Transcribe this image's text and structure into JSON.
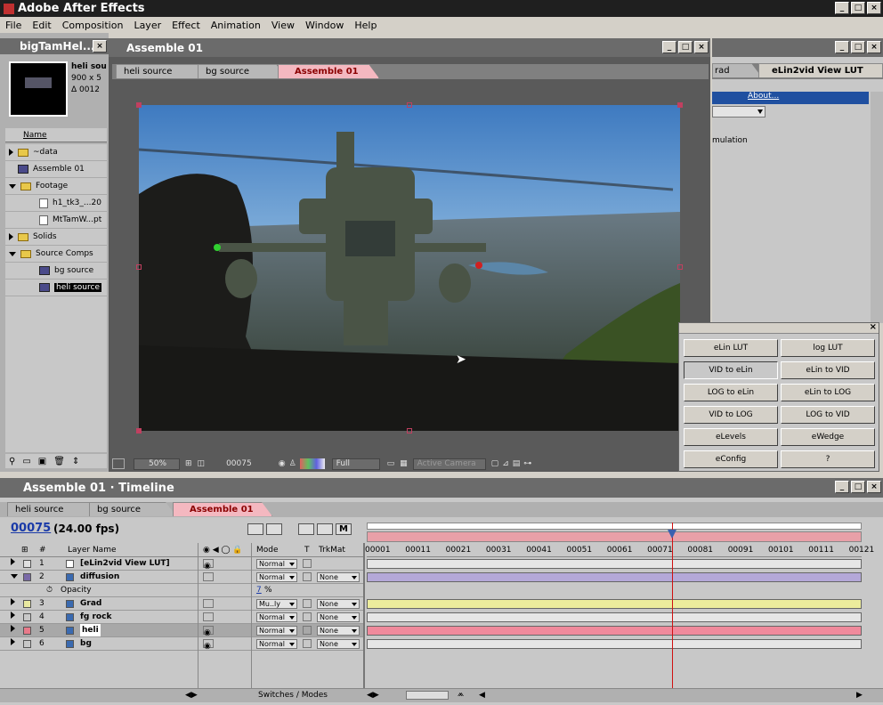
{
  "app": {
    "title": "Adobe After Effects"
  },
  "menu": [
    "File",
    "Edit",
    "Composition",
    "Layer",
    "Effect",
    "Animation",
    "View",
    "Window",
    "Help"
  ],
  "project": {
    "title": "bigTamHel...",
    "selected_name": "heli sou",
    "selected_dims": "900 x 5",
    "selected_dur": "Δ 0012",
    "column_name": "Name",
    "items": [
      {
        "label": "~data",
        "type": "folder",
        "open": false,
        "indent": 0
      },
      {
        "label": "Assemble 01",
        "type": "comp",
        "indent": 0
      },
      {
        "label": "Footage",
        "type": "folder",
        "open": true,
        "indent": 0
      },
      {
        "label": "h1_tk3_...20",
        "type": "seq",
        "indent": 1
      },
      {
        "label": "MtTamW...pt",
        "type": "file",
        "indent": 1
      },
      {
        "label": "Solids",
        "type": "folder",
        "open": false,
        "indent": 0
      },
      {
        "label": "Source Comps",
        "type": "folder",
        "open": true,
        "indent": 0
      },
      {
        "label": "bg source",
        "type": "comp",
        "indent": 1
      },
      {
        "label": "heli source",
        "type": "comp",
        "indent": 1,
        "selected": true
      }
    ]
  },
  "comp": {
    "title": "Assemble 01",
    "tabs": [
      "heli source",
      "bg source",
      "Assemble 01"
    ],
    "zoom": "50%",
    "frame": "00075",
    "resolution": "Full",
    "camera": "Active Camera"
  },
  "effect_panel": {
    "tabs": [
      "rad",
      "eLin2vid View LUT"
    ],
    "about": "About...",
    "text": "mulation"
  },
  "lut_panel": {
    "buttons": [
      "eLin LUT",
      "log LUT",
      "VID to eLin",
      "eLin to VID",
      "LOG to eLin",
      "eLin to LOG",
      "VID to LOG",
      "LOG to VID",
      "eLevels",
      "eWedge",
      "eConfig",
      "?"
    ]
  },
  "timeline": {
    "title": "Assemble 01 · Timeline",
    "tabs": [
      "heli source",
      "bg source",
      "Assemble 01"
    ],
    "timecode": "00075",
    "fps": "(24.00 fps)",
    "headers": {
      "num": "#",
      "layer": "Layer Name",
      "mode": "Mode",
      "t": "T",
      "trkmat": "TrkMat"
    },
    "layers": [
      {
        "num": "1",
        "name": "[eLin2vid View LUT]",
        "mode": "Normal",
        "trkmat": "",
        "color": "#e0e0e0",
        "bar": "#e6e6e6"
      },
      {
        "num": "2",
        "name": "diffusion",
        "mode": "Normal",
        "trkmat": "None",
        "color": "#7a6aa8",
        "bar": "#b4a8d8",
        "open": true
      },
      {
        "num": "3",
        "name": "Grad",
        "mode": "Mu..ly",
        "trkmat": "None",
        "color": "#e8e8a0",
        "bar": "#ecec9c"
      },
      {
        "num": "4",
        "name": "fg rock",
        "mode": "Normal",
        "trkmat": "None",
        "color": "#c8c8c8",
        "bar": "#e6e6e6"
      },
      {
        "num": "5",
        "name": "heli",
        "mode": "Normal",
        "trkmat": "None",
        "color": "#e87a8a",
        "bar": "#f08a9c",
        "selected": true
      },
      {
        "num": "6",
        "name": "bg",
        "mode": "Normal",
        "trkmat": "None",
        "color": "#c8c8c8",
        "bar": "#e6e6e6"
      }
    ],
    "opacity_label": "Opacity",
    "opacity_value": "7",
    "opacity_unit": "%",
    "ruler": [
      "00001",
      "00011",
      "00021",
      "00031",
      "00041",
      "00051",
      "00061",
      "00071",
      "00081",
      "00091",
      "00101",
      "00111",
      "00121"
    ],
    "switches_modes": "Switches / Modes",
    "playhead_frame": 75
  }
}
